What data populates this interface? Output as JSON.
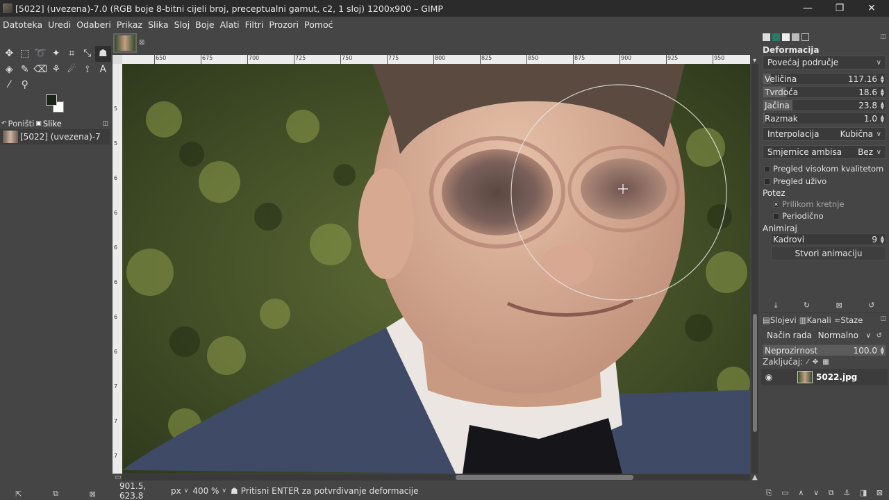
{
  "window": {
    "title": "[5022] (uvezena)-7.0 (RGB boje 8-bitni cijeli broj, preceptualni gamut, c2, 1 sloj) 1200x900 – GIMP",
    "minimize": "—",
    "maximize": "❐",
    "close": "✕"
  },
  "menubar": [
    "Datoteka",
    "Uredi",
    "Odaberi",
    "Prikaz",
    "Slika",
    "Sloj",
    "Boje",
    "Alati",
    "Filtri",
    "Prozori",
    "Pomoć"
  ],
  "toolbox": {
    "tools": [
      {
        "icon": "move-icon",
        "glyph": "✥"
      },
      {
        "icon": "rect-select-icon",
        "glyph": "⬚"
      },
      {
        "icon": "lasso-icon",
        "glyph": "➰"
      },
      {
        "icon": "fuzzy-select-icon",
        "glyph": "✦"
      },
      {
        "icon": "crop-icon",
        "glyph": "⌗"
      },
      {
        "icon": "unified-transform-icon",
        "glyph": "⤡"
      },
      {
        "icon": "warp-transform-icon",
        "glyph": "☗"
      },
      {
        "icon": "bucket-fill-icon",
        "glyph": "◈"
      },
      {
        "icon": "paintbrush-icon",
        "glyph": "✎"
      },
      {
        "icon": "eraser-icon",
        "glyph": "⌫"
      },
      {
        "icon": "clone-icon",
        "glyph": "⚘"
      },
      {
        "icon": "smudge-icon",
        "glyph": "☄"
      },
      {
        "icon": "paths-icon",
        "glyph": "⟟"
      },
      {
        "icon": "text-icon",
        "glyph": "A"
      },
      {
        "icon": "color-picker-icon",
        "glyph": "⁄"
      },
      {
        "icon": "zoom-icon",
        "glyph": "⚲"
      }
    ],
    "tabs": [
      "Poništi",
      "Slike"
    ],
    "image_item": "[5022] (uvezena)-7"
  },
  "ruler": {
    "top_labels": [
      "650",
      "675",
      "700",
      "725",
      "750",
      "775",
      "800",
      "825",
      "850",
      "875",
      "900",
      "925",
      "950"
    ],
    "left_labels": [
      "5",
      "5",
      "6",
      "6",
      "6",
      "6",
      "6",
      "6",
      "7",
      "7",
      "7",
      "7"
    ]
  },
  "statusbar": {
    "coords": "901.5, 623.8",
    "unit": "px",
    "zoom": "400 %",
    "message": "Pritisni ENTER za potvrđivanje deformacije"
  },
  "tool_options": {
    "title": "Deformacija",
    "mode": "Povećaj područje",
    "sliders": [
      {
        "name": "Veličina",
        "value": "117.16",
        "fill": 0.06
      },
      {
        "name": "Tvrdoća",
        "value": "18.6",
        "fill": 0.19
      },
      {
        "name": "Jačina",
        "value": "23.8",
        "fill": 0.24
      },
      {
        "name": "Razmak",
        "value": "1.0",
        "fill": 0.01
      }
    ],
    "interpolation_label": "Interpolacija",
    "interpolation_value": "Kubična",
    "abyss_label": "Smjernice ambisa",
    "abyss_value": "Bez",
    "hq_preview": "Pregled visokom kvalitetom",
    "live_preview": "Pregled uživo",
    "stroke_label": "Potez",
    "during_motion": "Prilikom kretnje",
    "periodic": "Periodično",
    "animate_label": "Animiraj",
    "frames_label": "Kadrovi",
    "frames_value": "9",
    "create_animation": "Stvori animaciju"
  },
  "layers": {
    "tabs": [
      "Slojevi",
      "Kanali",
      "Staze"
    ],
    "mode_label": "Način rada",
    "mode_value": "Normalno",
    "opacity_label": "Neprozirnost",
    "opacity_value": "100.0",
    "lock_label": "Zaključaj:",
    "layer_name": "5022.jpg"
  },
  "colors": {
    "background": "#454545",
    "foreground_swatch": "#1a2518",
    "background_swatch": "#ffffff"
  }
}
